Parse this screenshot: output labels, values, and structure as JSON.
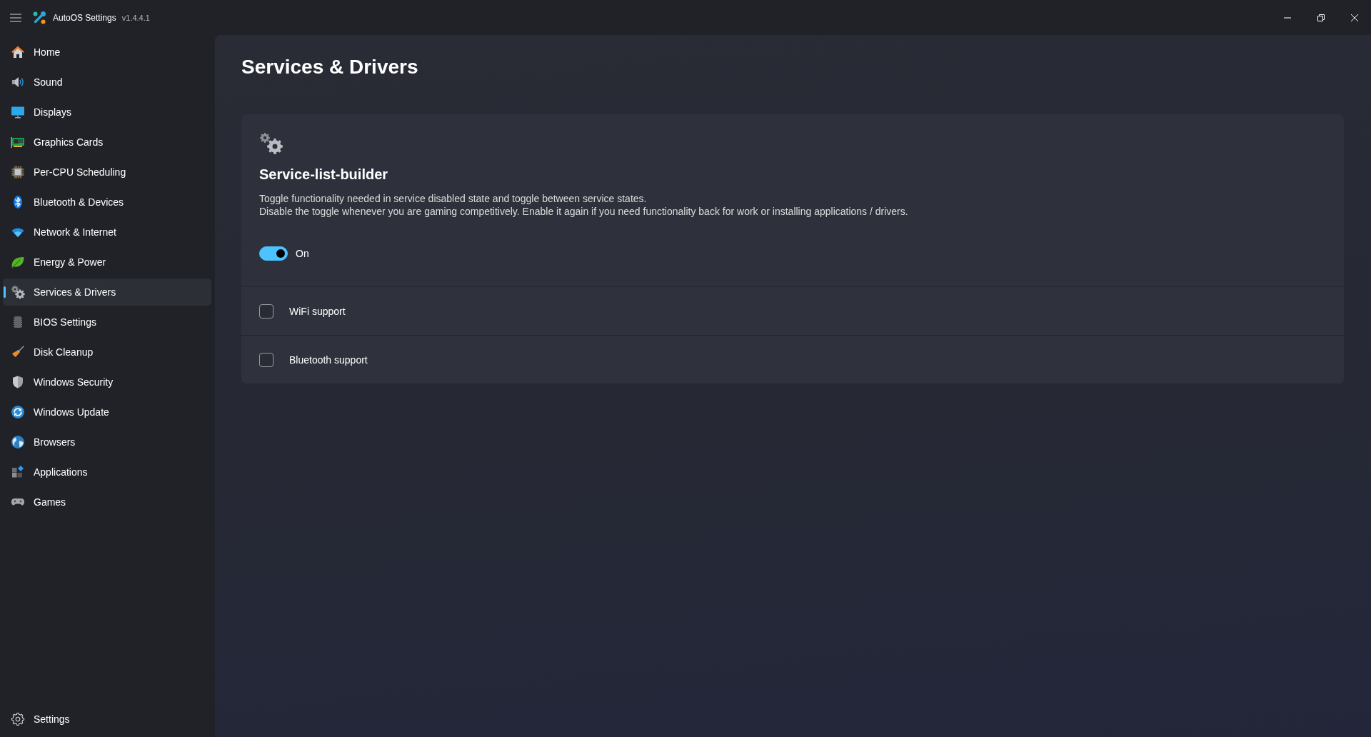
{
  "window": {
    "title": "AutoOS Settings",
    "version": "v1.4.4.1"
  },
  "sidebar": {
    "items": [
      {
        "label": "Home",
        "selected": false
      },
      {
        "label": "Sound",
        "selected": false
      },
      {
        "label": "Displays",
        "selected": false
      },
      {
        "label": "Graphics Cards",
        "selected": false
      },
      {
        "label": "Per-CPU Scheduling",
        "selected": false
      },
      {
        "label": "Bluetooth & Devices",
        "selected": false
      },
      {
        "label": "Network & Internet",
        "selected": false
      },
      {
        "label": "Energy & Power",
        "selected": false
      },
      {
        "label": "Services & Drivers",
        "selected": true
      },
      {
        "label": "BIOS Settings",
        "selected": false
      },
      {
        "label": "Disk Cleanup",
        "selected": false
      },
      {
        "label": "Windows Security",
        "selected": false
      },
      {
        "label": "Windows Update",
        "selected": false
      },
      {
        "label": "Browsers",
        "selected": false
      },
      {
        "label": "Applications",
        "selected": false
      },
      {
        "label": "Games",
        "selected": false
      }
    ],
    "footer": {
      "label": "Settings"
    }
  },
  "page": {
    "title": "Services & Drivers"
  },
  "card": {
    "title": "Service-list-builder",
    "description": [
      "Toggle functionality needed in service disabled state and toggle between service states.",
      "Disable the toggle whenever you are gaming competitively. Enable it again if you need functionality back for work or installing applications / drivers."
    ],
    "toggle": {
      "on": true,
      "label": "On"
    },
    "options": [
      {
        "label": "WiFi support",
        "checked": false
      },
      {
        "label": "Bluetooth support",
        "checked": false
      }
    ]
  }
}
